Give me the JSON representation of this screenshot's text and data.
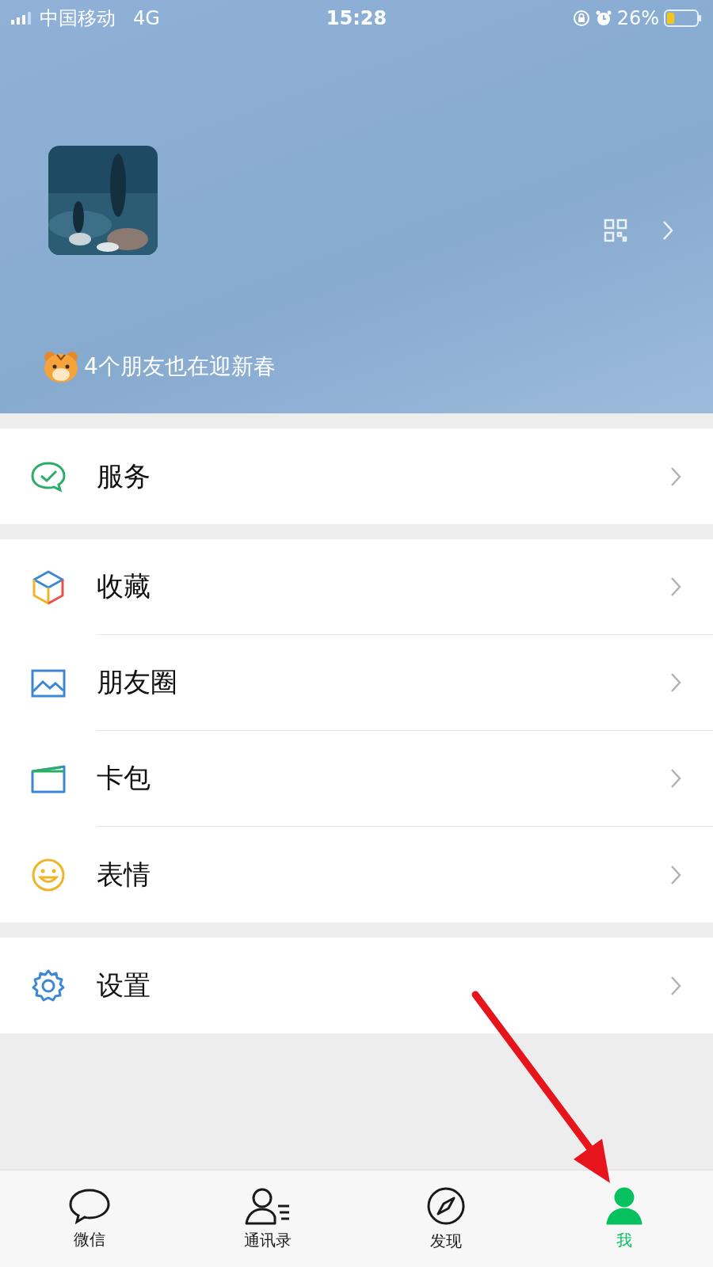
{
  "status_bar": {
    "carrier": "中国移动",
    "network": "4G",
    "time": "15:28",
    "battery": "26%"
  },
  "profile": {
    "banner": "4个朋友也在迎新春"
  },
  "menu_groups": [
    [
      {
        "label": "服务"
      }
    ],
    [
      {
        "label": "收藏"
      },
      {
        "label": "朋友圈"
      },
      {
        "label": "卡包"
      },
      {
        "label": "表情"
      }
    ],
    [
      {
        "label": "设置"
      }
    ]
  ],
  "tab_bar": [
    {
      "label": "微信",
      "selected": false
    },
    {
      "label": "通讯录",
      "selected": false
    },
    {
      "label": "发现",
      "selected": false
    },
    {
      "label": "我",
      "selected": true
    }
  ]
}
